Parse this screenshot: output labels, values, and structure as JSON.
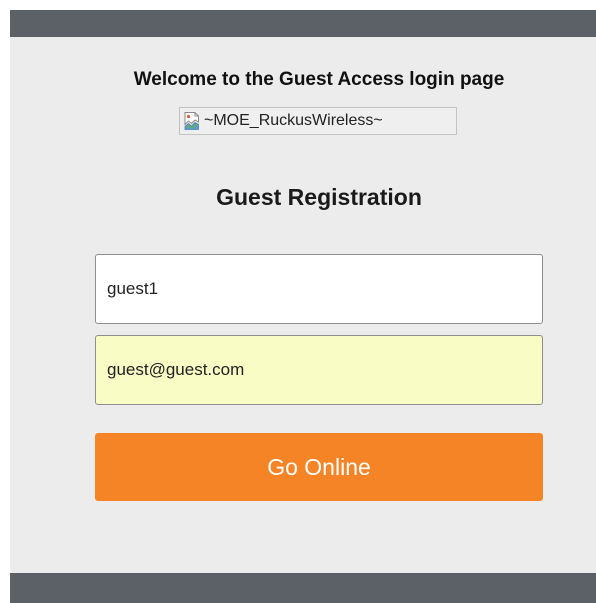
{
  "colors": {
    "bar": "#5c6168",
    "panel_bg": "#ececec",
    "button_bg": "#f58427",
    "button_text": "#ffffff",
    "autofill_bg": "#fafcc5"
  },
  "header": {
    "welcome_text": "Welcome to the Guest Access login page"
  },
  "logo": {
    "icon": "broken-image-icon",
    "alt_text": "~MOE_RuckusWireless~"
  },
  "form": {
    "title": "Guest Registration",
    "name_field": {
      "value": "guest1"
    },
    "email_field": {
      "value": "guest@guest.com"
    },
    "submit_label": "Go Online"
  }
}
